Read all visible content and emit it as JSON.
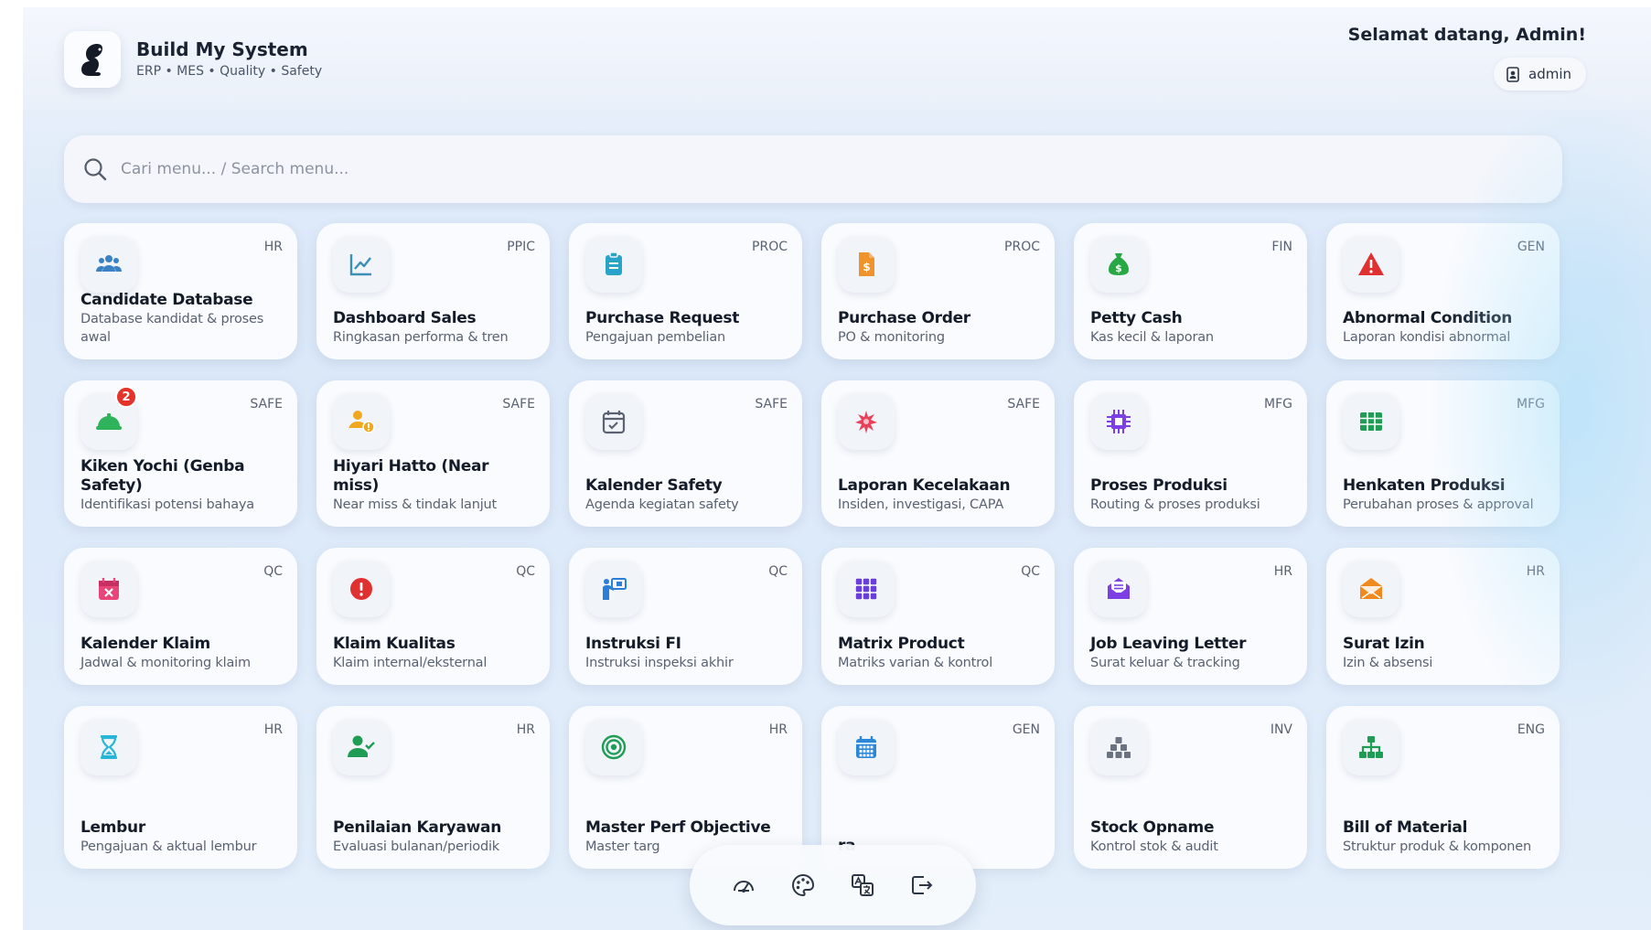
{
  "header": {
    "brand_title": "Build My System",
    "brand_subtitle": "ERP • MES • Quality • Safety",
    "welcome": "Selamat datang, Admin!",
    "user": "admin",
    "logo_icon": "squirrel-logo"
  },
  "search": {
    "placeholder": "Cari menu... / Search menu..."
  },
  "cards": [
    {
      "title": "Candidate Database",
      "desc": "Database kandidat & proses awal",
      "tag": "HR",
      "icon": "users-icon",
      "color": "#3b82c4"
    },
    {
      "title": "Dashboard Sales",
      "desc": "Ringkasan performa & tren",
      "tag": "PPIC",
      "icon": "line-chart-icon",
      "color": "#3d8fb8"
    },
    {
      "title": "Purchase Request",
      "desc": "Pengajuan pembelian",
      "tag": "PROC",
      "icon": "clipboard-icon",
      "color": "#2aa3c9"
    },
    {
      "title": "Purchase Order",
      "desc": "PO & monitoring",
      "tag": "PROC",
      "icon": "invoice-icon",
      "color": "#f0932b"
    },
    {
      "title": "Petty Cash",
      "desc": "Kas kecil & laporan",
      "tag": "FIN",
      "icon": "money-bag-icon",
      "color": "#28a745"
    },
    {
      "title": "Abnormal Condition",
      "desc": "Laporan kondisi abnormal",
      "tag": "GEN",
      "icon": "warning-icon",
      "color": "#e03131"
    },
    {
      "title": "Kiken Yochi (Genba Safety)",
      "desc": "Identifikasi potensi bahaya",
      "tag": "SAFE",
      "icon": "hard-hat-icon",
      "color": "#2fb35a",
      "badge": "2"
    },
    {
      "title": "Hiyari Hatto (Near miss)",
      "desc": "Near miss & tindak lanjut",
      "tag": "SAFE",
      "icon": "user-alert-icon",
      "color": "#f0a81e"
    },
    {
      "title": "Kalender Safety",
      "desc": "Agenda kegiatan safety",
      "tag": "SAFE",
      "icon": "calendar-check-icon",
      "color": "#5b6272"
    },
    {
      "title": "Laporan Kecelakaan",
      "desc": "Insiden, investigasi, CAPA",
      "tag": "SAFE",
      "icon": "accident-icon",
      "color": "#e8425a"
    },
    {
      "title": "Proses Produksi",
      "desc": "Routing & proses produksi",
      "tag": "MFG",
      "icon": "chip-icon",
      "color": "#7b3fe4"
    },
    {
      "title": "Henkaten Produksi",
      "desc": "Perubahan proses & approval",
      "tag": "MFG",
      "icon": "table-grid-icon",
      "color": "#1f9d55"
    },
    {
      "title": "Kalender Klaim",
      "desc": "Jadwal & monitoring klaim",
      "tag": "QC",
      "icon": "calendar-x-icon",
      "color": "#e8457a"
    },
    {
      "title": "Klaim Kualitas",
      "desc": "Klaim internal/eksternal",
      "tag": "QC",
      "icon": "alert-circle-icon",
      "color": "#e03131"
    },
    {
      "title": "Instruksi FI",
      "desc": "Instruksi inspeksi akhir",
      "tag": "QC",
      "icon": "presenter-icon",
      "color": "#2b7fd6"
    },
    {
      "title": "Matrix Product",
      "desc": "Matriks varian & kontrol",
      "tag": "QC",
      "icon": "grid-dots-icon",
      "color": "#6a3fd9"
    },
    {
      "title": "Job Leaving Letter",
      "desc": "Surat keluar & tracking",
      "tag": "HR",
      "icon": "envelope-open-icon",
      "color": "#7b3fe4"
    },
    {
      "title": "Surat Izin",
      "desc": "Izin & absensi",
      "tag": "HR",
      "icon": "envelope-icon",
      "color": "#f08a1e"
    },
    {
      "title": "Lembur",
      "desc": "Pengajuan & aktual lembur",
      "tag": "HR",
      "icon": "hourglass-icon",
      "color": "#28b6d8"
    },
    {
      "title": "Penilaian Karyawan",
      "desc": "Evaluasi bulanan/periodik",
      "tag": "HR",
      "icon": "user-check-icon",
      "color": "#1f9d55"
    },
    {
      "title": "Master Perf Objective",
      "desc": "Master targ",
      "tag": "HR",
      "icon": "target-icon",
      "color": "#1f9d55"
    },
    {
      "title": "ra",
      "desc": "",
      "tag": "GEN",
      "icon": "calendar-icon",
      "color": "#2b88d8"
    },
    {
      "title": "Stock Opname",
      "desc": "Kontrol stok & audit",
      "tag": "INV",
      "icon": "boxes-icon",
      "color": "#6b7280"
    },
    {
      "title": "Bill of Material",
      "desc": "Struktur produk & komponen",
      "tag": "ENG",
      "icon": "sitemap-icon",
      "color": "#1f9d55"
    }
  ],
  "dock": [
    {
      "icon": "dashboard-gauge-icon"
    },
    {
      "icon": "palette-icon"
    },
    {
      "icon": "translate-icon"
    },
    {
      "icon": "logout-icon"
    }
  ]
}
